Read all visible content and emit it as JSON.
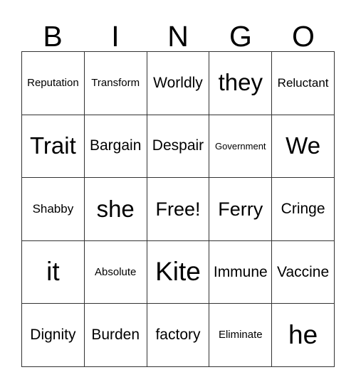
{
  "card": {
    "title": "Bingo Card",
    "header_letters": [
      "B",
      "I",
      "N",
      "G",
      "O"
    ],
    "grid_size": "5x5",
    "border_color": "#333333",
    "background_color": "#ffffff",
    "text_color": "#000000",
    "rows": [
      [
        {
          "text": "Reputation",
          "size": "s"
        },
        {
          "text": "Transform",
          "size": "s"
        },
        {
          "text": "Worldly",
          "size": "l"
        },
        {
          "text": "they",
          "size": "xxl"
        },
        {
          "text": "Reluctant",
          "size": "m"
        }
      ],
      [
        {
          "text": "Trait",
          "size": "xxl"
        },
        {
          "text": "Bargain",
          "size": "l"
        },
        {
          "text": "Despair",
          "size": "l"
        },
        {
          "text": "Government",
          "size": "xs"
        },
        {
          "text": "We",
          "size": "xxl"
        }
      ],
      [
        {
          "text": "Shabby",
          "size": "m"
        },
        {
          "text": "she",
          "size": "xxl"
        },
        {
          "text": "Free!",
          "size": "xl"
        },
        {
          "text": "Ferry",
          "size": "xl"
        },
        {
          "text": "Cringe",
          "size": "l"
        }
      ],
      [
        {
          "text": "it",
          "size": "huge"
        },
        {
          "text": "Absolute",
          "size": "s"
        },
        {
          "text": "Kite",
          "size": "huge"
        },
        {
          "text": "Immune",
          "size": "l"
        },
        {
          "text": "Vaccine",
          "size": "l"
        }
      ],
      [
        {
          "text": "Dignity",
          "size": "l"
        },
        {
          "text": "Burden",
          "size": "l"
        },
        {
          "text": "factory",
          "size": "l"
        },
        {
          "text": "Eliminate",
          "size": "s"
        },
        {
          "text": "he",
          "size": "huge"
        }
      ]
    ]
  }
}
